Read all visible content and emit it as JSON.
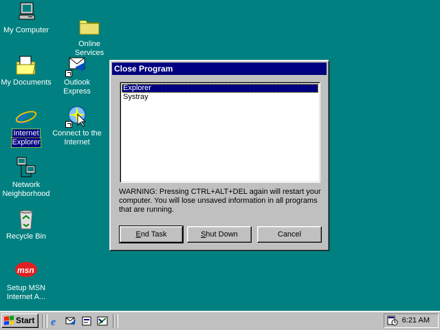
{
  "desktop": {
    "icons": [
      {
        "label_lines": [
          "My Computer"
        ],
        "icon": "computer-icon"
      },
      {
        "label_lines": [
          "Online",
          "Services"
        ],
        "icon": "folder-icon"
      },
      {
        "label_lines": [
          "My Documents"
        ],
        "icon": "documents-folder-icon"
      },
      {
        "label_lines": [
          "Outlook",
          "Express"
        ],
        "icon": "outlook-express-icon"
      },
      {
        "label_lines": [
          "Internet",
          "Explorer"
        ],
        "icon": "internet-explorer-icon",
        "selected": true
      },
      {
        "label_lines": [
          "Connect to the",
          "Internet"
        ],
        "icon": "connect-internet-icon"
      },
      {
        "label_lines": [
          "Network",
          "Neighborhood"
        ],
        "icon": "network-icon"
      },
      {
        "label_lines": [
          "Recycle Bin"
        ],
        "icon": "recycle-bin-icon"
      },
      {
        "label_lines": [
          "Setup MSN",
          "Internet A..."
        ],
        "icon": "msn-icon"
      }
    ]
  },
  "dialog": {
    "title": "Close Program",
    "programs": [
      "Explorer",
      "Systray"
    ],
    "selected_program": "Explorer",
    "warning": "WARNING: Pressing CTRL+ALT+DEL again will restart your computer. You will lose unsaved information in all programs that are running.",
    "buttons": {
      "end_task": {
        "mnemonic": "E",
        "rest": "nd Task"
      },
      "shut_down": {
        "mnemonic": "S",
        "rest": "hut Down"
      },
      "cancel": "Cancel"
    }
  },
  "taskbar": {
    "start_label": "Start",
    "quick_launch": [
      "internet-explorer-icon",
      "outlook-express-icon",
      "show-desktop-icon",
      "channels-icon"
    ],
    "clock": "6:21 AM",
    "colors": {
      "face": "#c0c0c0",
      "desktop": "#008080",
      "title": "#000080"
    }
  }
}
